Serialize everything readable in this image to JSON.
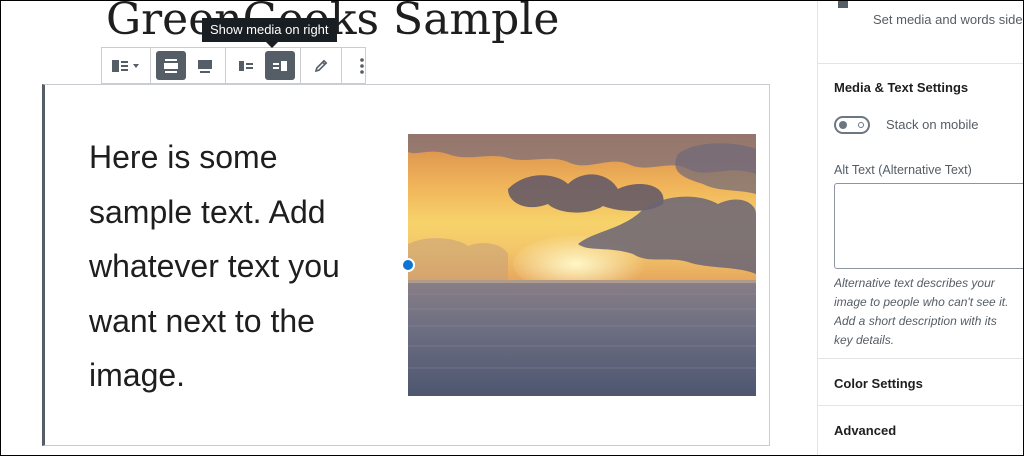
{
  "editor": {
    "page_title": "GreenGeeks Sample",
    "tooltip": "Show media on right",
    "block_text": "Here is some sample text. Add whatever text you want next to the image."
  },
  "toolbar": {
    "buttons": [
      {
        "icon": "block-type-icon"
      },
      {
        "icon": "wide-width-icon",
        "active": true
      },
      {
        "icon": "full-width-icon"
      },
      {
        "icon": "media-left-icon"
      },
      {
        "icon": "media-right-icon",
        "active": true
      },
      {
        "icon": "pencil-icon"
      },
      {
        "icon": "more-options-icon"
      }
    ]
  },
  "sidebar": {
    "block_description": "Set media and words side by side for a richer layout.",
    "media_text_settings_heading": "Media & Text Settings",
    "stack_on_mobile_label": "Stack on mobile",
    "stack_on_mobile_enabled": false,
    "alt_text_label": "Alt Text (Alternative Text)",
    "alt_text_value": "",
    "alt_text_help": "Alternative text describes your image to people who can't see it. Add a short description with its key details.",
    "color_settings_heading": "Color Settings",
    "advanced_heading": "Advanced"
  },
  "colors": {
    "accent": "#0e74d4",
    "toolbar_active": "#555d66",
    "tooltip_bg": "#191e23"
  }
}
